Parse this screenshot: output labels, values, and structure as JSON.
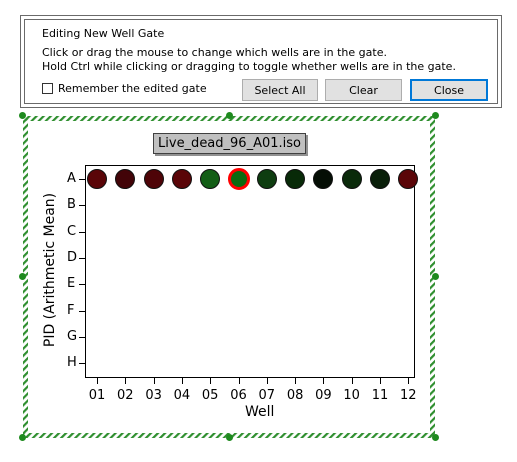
{
  "dialog": {
    "title": "Editing New Well Gate",
    "instruction_line1": "Click or drag the mouse to change which wells are in the gate.",
    "instruction_line2": "Hold Ctrl while clicking or dragging to toggle whether wells are in the gate.",
    "remember_label": "Remember the edited gate",
    "remember_checked": false,
    "select_all_label": "Select All",
    "clear_label": "Clear",
    "close_label": "Close"
  },
  "plot": {
    "file_label": "Live_dead_96_A01.iso",
    "y_axis_label": "PID (Arithmetic Mean)",
    "x_axis_label": "Well",
    "rows": [
      "A",
      "B",
      "C",
      "D",
      "E",
      "F",
      "G",
      "H"
    ],
    "columns": [
      "01",
      "02",
      "03",
      "04",
      "05",
      "06",
      "07",
      "08",
      "09",
      "10",
      "11",
      "12"
    ],
    "wells": [
      {
        "row": "A",
        "column": "01",
        "color": "#5a0508",
        "selected": false
      },
      {
        "row": "A",
        "column": "02",
        "color": "#420408",
        "selected": false
      },
      {
        "row": "A",
        "column": "03",
        "color": "#4e0408",
        "selected": false
      },
      {
        "row": "A",
        "column": "04",
        "color": "#5a0508",
        "selected": false
      },
      {
        "row": "A",
        "column": "05",
        "color": "#135e16",
        "selected": false
      },
      {
        "row": "A",
        "column": "06",
        "color": "#0c6a10",
        "selected": true
      },
      {
        "row": "A",
        "column": "07",
        "color": "#0e3d10",
        "selected": false
      },
      {
        "row": "A",
        "column": "08",
        "color": "#082a08",
        "selected": false
      },
      {
        "row": "A",
        "column": "09",
        "color": "#050e05",
        "selected": false
      },
      {
        "row": "A",
        "column": "10",
        "color": "#0a2a0a",
        "selected": false
      },
      {
        "row": "A",
        "column": "11",
        "color": "#0a1f0a",
        "selected": false
      },
      {
        "row": "A",
        "column": "12",
        "color": "#5a0508",
        "selected": false
      }
    ]
  },
  "colors": {
    "selection_frame": "#2f8f2f",
    "selected_well_ring": "#ff0000"
  }
}
